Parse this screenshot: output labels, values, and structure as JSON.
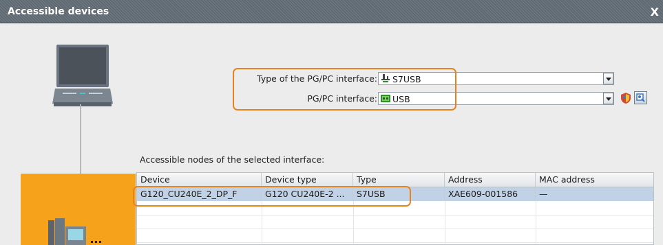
{
  "dialog": {
    "title": "Accessible devices",
    "close_glyph": "X"
  },
  "pgpc": {
    "type_label": "Type of the PG/PC interface:",
    "type_value": "S7USB",
    "interface_label": "PG/PC interface:",
    "interface_value": "USB"
  },
  "nodes": {
    "label": "Accessible nodes of the selected interface:",
    "columns": [
      "Device",
      "Device type",
      "Type",
      "Address",
      "MAC address"
    ],
    "rows": [
      {
        "device": "G120_CU240E_2_DP_F",
        "device_type": "G120 CU240E-2 ...",
        "type": "S7USB",
        "address": "XAE609-001586",
        "mac": "—"
      }
    ]
  },
  "icons": [
    "laptop-icon",
    "usb-plug-icon",
    "usb-card-icon",
    "shield-icon",
    "flash-led-icon",
    "devices-icon"
  ],
  "colors": {
    "accent": "#f7a21b",
    "highlight": "#e8821c",
    "selection": "#c2d2e6",
    "titlebar": "#5f6972"
  }
}
